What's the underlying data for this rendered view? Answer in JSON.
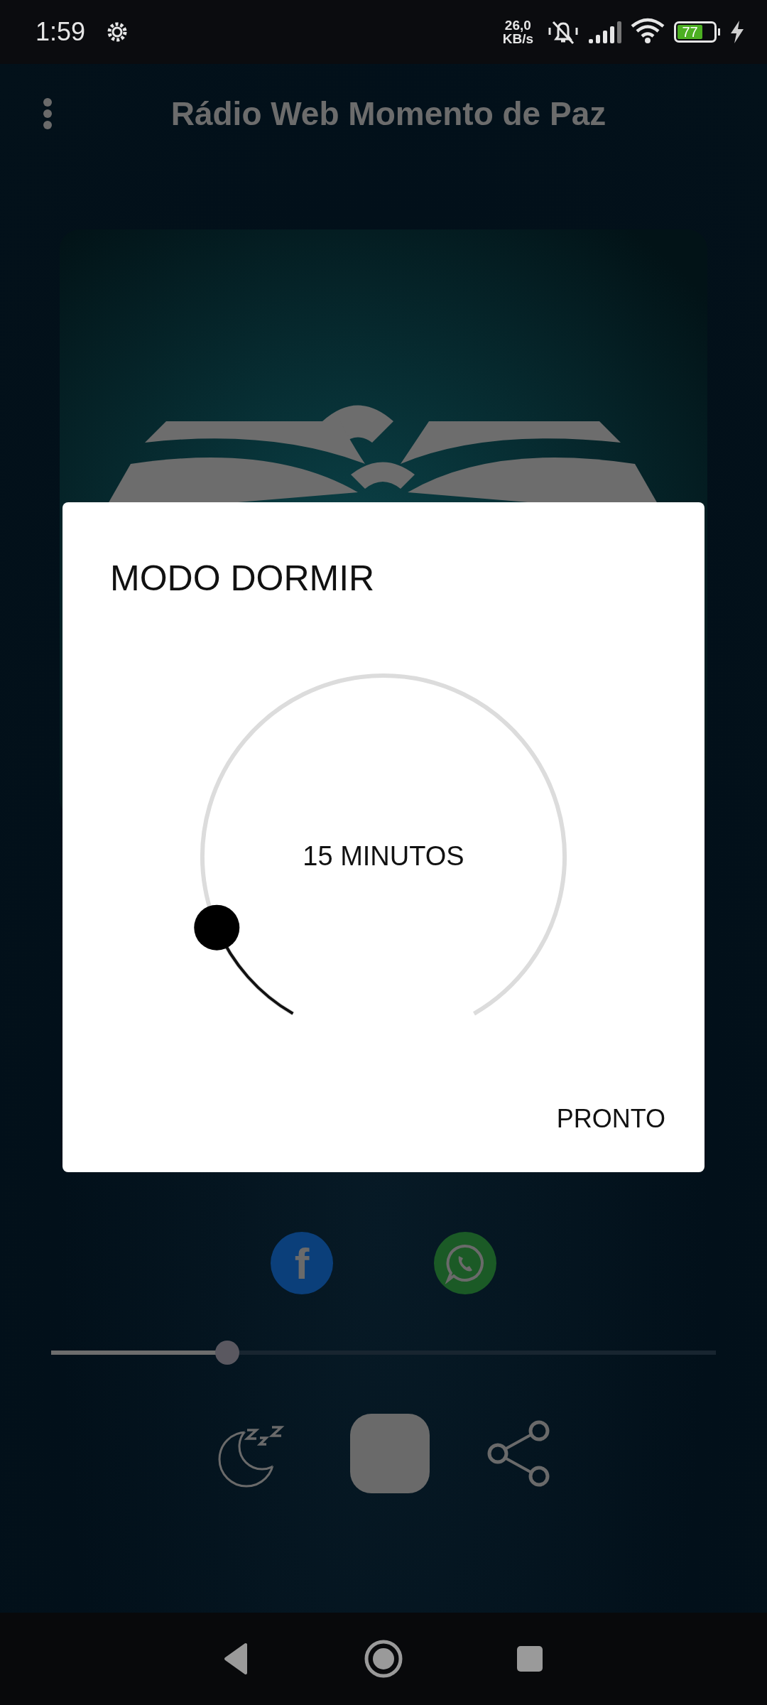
{
  "status_bar": {
    "time": "1:59",
    "net_speed": "26,0",
    "net_unit": "KB/s",
    "battery": "77"
  },
  "header": {
    "title": "Rádio Web Momento de Paz"
  },
  "share_links": [
    {
      "kind": "letter",
      "label": "f",
      "color": "#0b3f7a"
    },
    {
      "kind": "chat",
      "color": "#1b5a26"
    }
  ],
  "volume": {
    "level": 0.265
  },
  "controls": [
    {
      "kind": "sleep"
    },
    {
      "kind": "stop"
    },
    {
      "kind": "share"
    }
  ],
  "dialog": {
    "title": "MODO DORMIR",
    "timer": {
      "label": "15 MINUTOS"
    },
    "action": "PRONTO"
  },
  "nav_bar": [
    {
      "kind": "back"
    },
    {
      "kind": "home"
    },
    {
      "kind": "recents"
    }
  ]
}
